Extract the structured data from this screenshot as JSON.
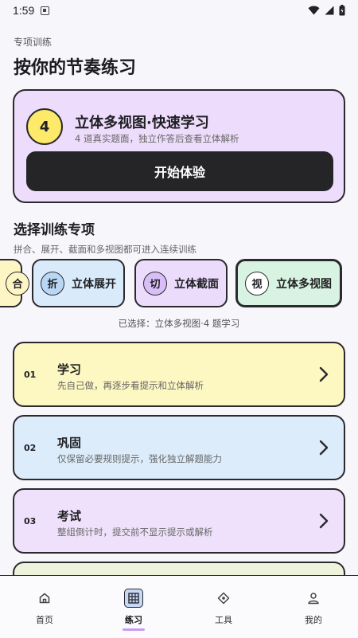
{
  "status": {
    "time": "1:59"
  },
  "header": {
    "subtitle": "专项训练",
    "title": "按你的节奏练习"
  },
  "hero": {
    "count": "4",
    "title": "立体多视图·快速学习",
    "desc": "4 道真实题面，独立作答后查看立体解析",
    "start_label": "开始体验"
  },
  "section": {
    "title": "选择训练专项",
    "desc": "拼合、展开、截面和多视图都可进入连续训练"
  },
  "chips": [
    {
      "icon_char": "合",
      "label": "",
      "color": "#fdf5c4"
    },
    {
      "icon_char": "折",
      "label": "立体展开",
      "color": "#d9ebfb"
    },
    {
      "icon_char": "切",
      "label": "立体截面",
      "color": "#ecdcfb"
    },
    {
      "icon_char": "视",
      "label": "立体多视图",
      "color": "#d8f3e1"
    }
  ],
  "selected_note": "已选择：立体多视图·4 题学习",
  "modes": [
    {
      "index": "01",
      "title": "学习",
      "desc": "先自己做，再逐步看提示和立体解析",
      "color": "#fdf7c2",
      "icon": "chevron-right-icon"
    },
    {
      "index": "02",
      "title": "巩固",
      "desc": "仅保留必要规则提示，强化独立解题能力",
      "color": "#dcecfb",
      "icon": "chevron-right-icon"
    },
    {
      "index": "03",
      "title": "考试",
      "desc": "整组倒计时，提交前不显示提示或解析",
      "color": "#efe1fb",
      "icon": "chevron-right-icon"
    }
  ],
  "tabs": [
    {
      "label": "首页",
      "icon": "home-icon"
    },
    {
      "label": "练习",
      "icon": "grid-icon",
      "active": true
    },
    {
      "label": "工具",
      "icon": "compass-icon"
    },
    {
      "label": "我的",
      "icon": "person-icon"
    }
  ]
}
